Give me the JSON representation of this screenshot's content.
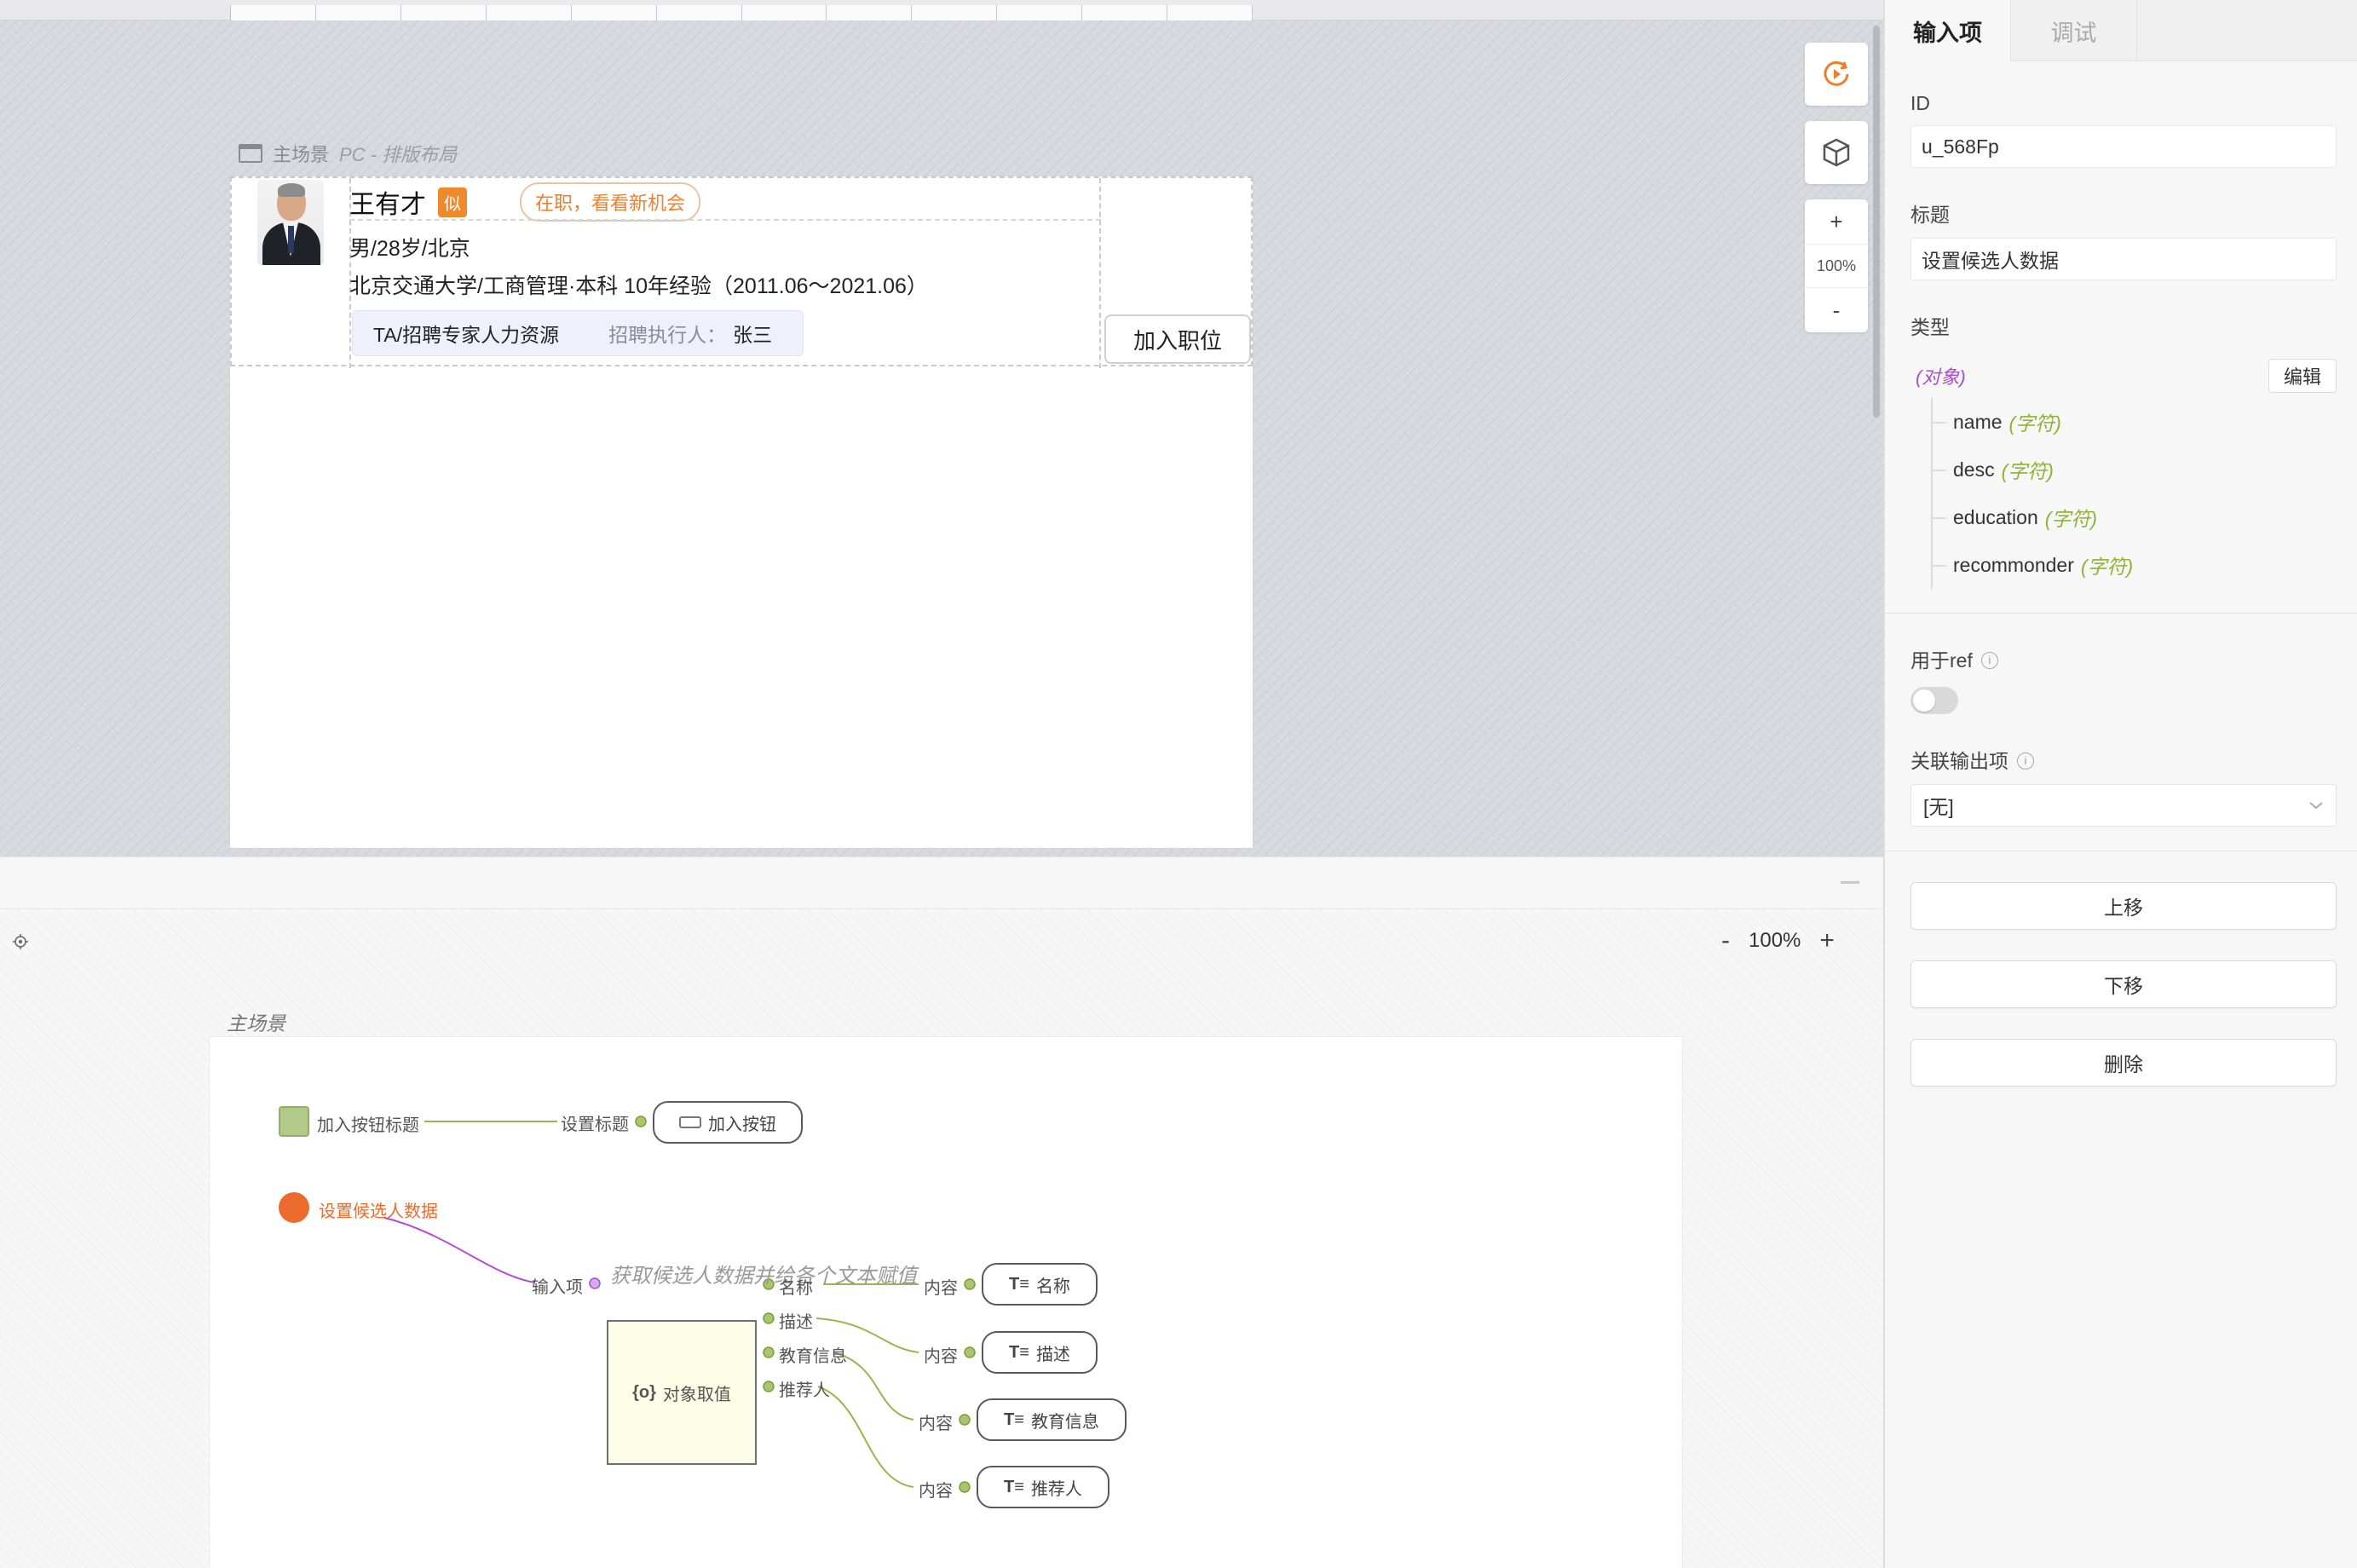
{
  "canvas": {
    "scene_label": "主场景",
    "scene_sub": "PC - 排版布局",
    "zoom_in": "+",
    "zoom_level": "100%",
    "zoom_out": "-"
  },
  "candidate": {
    "name": "王有才",
    "badge": "似",
    "status": "在职，看看新机会",
    "desc": "男/28岁/北京",
    "education": "北京交通大学/工商管理·本科  10年经验（2011.06～2021.06）",
    "role": "TA/招聘专家人力资源",
    "exec_label": "招聘执行人：",
    "exec_name": "张三",
    "join_button": "加入职位"
  },
  "logic": {
    "zoom_out": "-",
    "zoom_level": "100%",
    "zoom_in": "+",
    "scene_label": "主场景",
    "comment": "获取候选人数据并给各个文本赋值",
    "input1_label": "加入按钮标题",
    "set_title_label": "设置标题",
    "join_btn_comp": "加入按钮",
    "input2_label": "设置候选人数据",
    "input_item_label": "输入项",
    "obj_box_label": "对象取值",
    "outputs": [
      "名称",
      "描述",
      "教育信息",
      "推荐人"
    ],
    "content_label": "内容",
    "texts": [
      "名称",
      "描述",
      "教育信息",
      "推荐人"
    ]
  },
  "panel": {
    "tabs": [
      "输入项",
      "调试"
    ],
    "id_label": "ID",
    "id_value": "u_568Fp",
    "title_label": "标题",
    "title_value": "设置候选人数据",
    "type_label": "类型",
    "type_obj": "(对象)",
    "edit_button": "编辑",
    "fields": [
      {
        "name": "name",
        "type": "(字符)"
      },
      {
        "name": "desc",
        "type": "(字符)"
      },
      {
        "name": "education",
        "type": "(字符)"
      },
      {
        "name": "recommonder",
        "type": "(字符)"
      }
    ],
    "ref_label": "用于ref",
    "ref_help": "i",
    "assoc_label": "关联输出项",
    "assoc_help": "i",
    "assoc_value": "[无]",
    "move_up": "上移",
    "move_down": "下移",
    "delete": "删除"
  },
  "colors": {
    "accent_orange": "#ef7f2b",
    "purple": "#a552c9",
    "green": "#8fb333"
  }
}
